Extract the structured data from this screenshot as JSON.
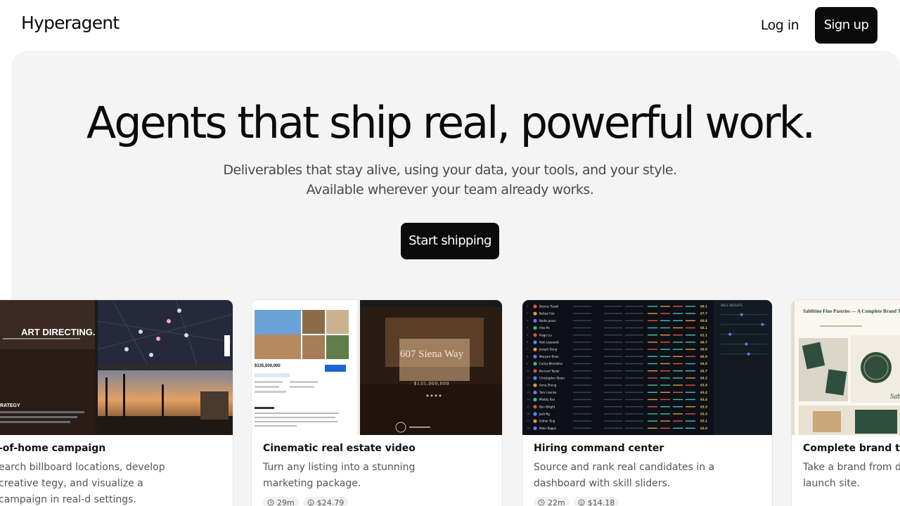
{
  "nav": {
    "logo": "Hyperagent",
    "login": "Log in",
    "signup": "Sign up"
  },
  "hero": {
    "headline": "Agents that ship real, powerful work.",
    "sub1": "Deliverables that stay alive, using your data, your tools, and your style.",
    "sub2": "Available wherever your team already works.",
    "cta": "Start shipping"
  },
  "cards": [
    {
      "title": "-of-home campaign",
      "desc": "earch billboard locations, develop creative tegy, and visualize a campaign in real-d settings.",
      "thumb": {
        "headline": "STOP EDITING. START DIRECTING.",
        "side_label": "ART DIRECTING.",
        "strategy": "RATEGY"
      }
    },
    {
      "title": "Cinematic real estate video",
      "desc": "Turn any listing into a stunning marketing package.",
      "time": "29m",
      "cost": "$24.79",
      "thumb": {
        "address": "607 Siena Way",
        "price": "$135,000,000",
        "price_small": "$135,000,000"
      }
    },
    {
      "title": "Hiring command center",
      "desc": "Source and rank real candidates in a dashboard with skill sliders.",
      "time": "22m",
      "cost": "$14.18",
      "thumb": {
        "header": "SKILL WEIGHTS",
        "candidates": [
          "Dennis Tissell",
          "Kelsey Cox",
          "Nadia Jones",
          "Alex Po",
          "Paige Liu",
          "Pam Lopewski",
          "Joseph Deng",
          "Maryam Khan",
          "Carlos Mendelez",
          "Bernard Taylor",
          "Christopher Slater",
          "Anna Zheng",
          "Tom Lisenko",
          "Maddy Rao",
          "Ben Wright",
          "Jack Ng",
          "Esther Ong",
          "Peter Kagan"
        ],
        "scores": [
          "68.1",
          "67.7",
          "60.8",
          "68.1",
          "62.1",
          "68.7",
          "66.9",
          "66.9",
          "64.8",
          "64.7",
          "64.3",
          "63.8",
          "63.4",
          "63.4",
          "63.3",
          "63.3",
          "63.1",
          "63.0"
        ],
        "colors": [
          "#e0533b",
          "#e39a2e",
          "#7c6cf0",
          "#3fb57a",
          "#e0533b",
          "#4a8cf0",
          "#e39a2e",
          "#7c6cf0",
          "#3fb57a",
          "#e0533b",
          "#4a8cf0",
          "#e39a2e",
          "#7c6cf0",
          "#3fb57a",
          "#e0533b",
          "#4a8cf0",
          "#e39a2e",
          "#7c6cf0"
        ]
      }
    },
    {
      "title": "Complete brand tra",
      "desc": "Take a brand from destination with a launch site.",
      "thumb": {
        "name": "Sablitine Fine Pastries — A Complete Brand Transformation",
        "brand": "Sabline"
      }
    }
  ]
}
